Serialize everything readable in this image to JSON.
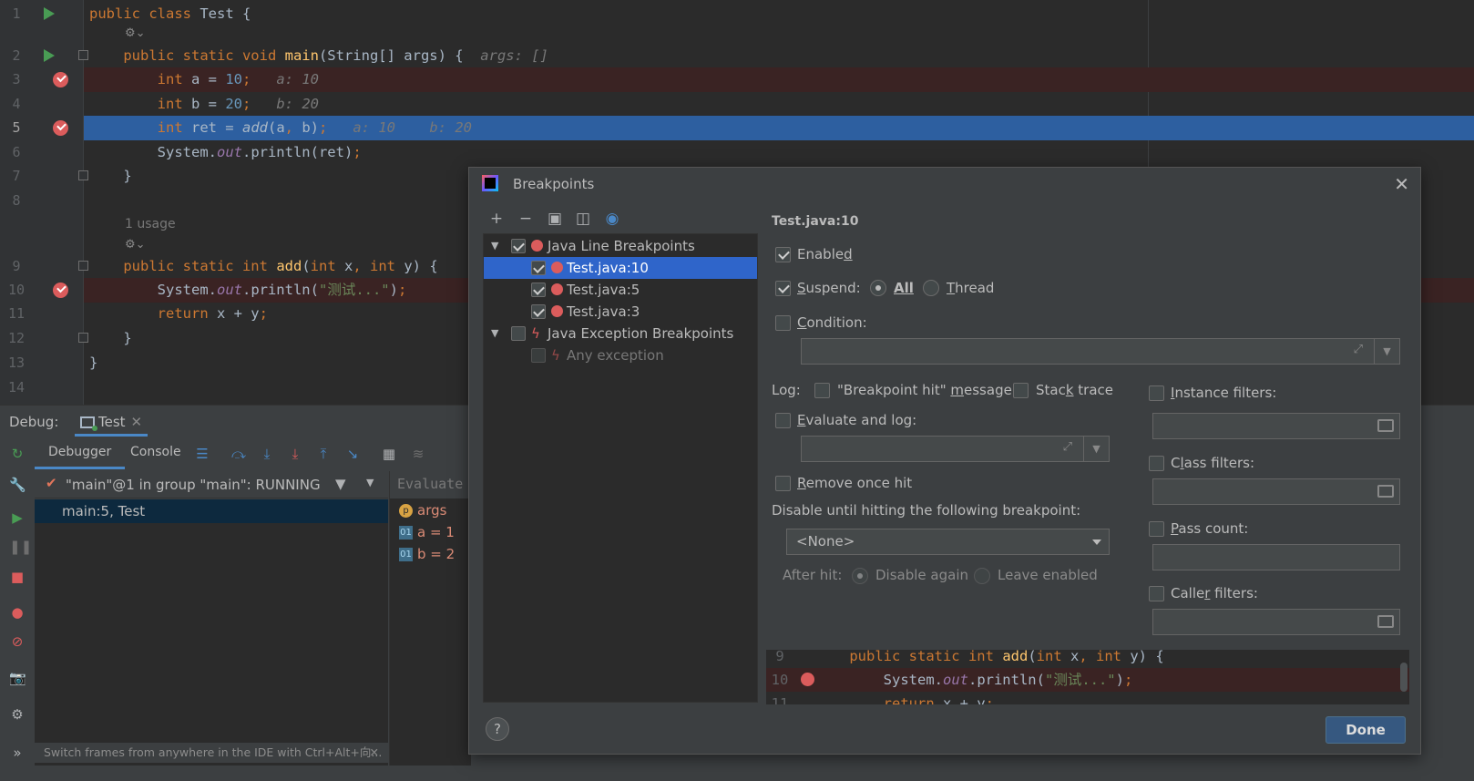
{
  "editor": {
    "lines": [
      {
        "num": "1"
      },
      {
        "num": "2"
      },
      {
        "num": "3"
      },
      {
        "num": "4"
      },
      {
        "num": "5"
      },
      {
        "num": "6"
      },
      {
        "num": "7"
      },
      {
        "num": "8"
      },
      {
        "num": "9"
      },
      {
        "num": "10"
      },
      {
        "num": "11"
      },
      {
        "num": "12"
      },
      {
        "num": "13"
      },
      {
        "num": "14"
      }
    ],
    "usage_hint": "1 usage",
    "inline": {
      "args": "args: []",
      "a": "a: 10",
      "b": "b: 20",
      "ret_a": "a: 10",
      "ret_b": "b: 20"
    }
  },
  "debug": {
    "label": "Debug:",
    "run_tab": "Test",
    "tabs": [
      "Debugger",
      "Console"
    ],
    "thread": "\"main\"@1 in group \"main\": RUNNING",
    "frame": "main:5, Test",
    "evaluate_placeholder": "Evaluate",
    "vars": [
      {
        "badge": "p",
        "text": "args"
      },
      {
        "badge": "01",
        "text": "a = 1"
      },
      {
        "badge": "01",
        "text": "b = 2"
      }
    ],
    "status": "Switch frames from anywhere in the IDE with Ctrl+Alt+向..."
  },
  "dialog": {
    "title": "Breakpoints",
    "tree": {
      "line_group": "Java Line Breakpoints",
      "items": [
        "Test.java:10",
        "Test.java:5",
        "Test.java:3"
      ],
      "exception_group": "Java Exception Breakpoints",
      "exception_item": "Any exception"
    },
    "selected_title": "Test.java:10",
    "enabled_pre": "Enable",
    "enabled_u": "d",
    "suspend_pre": "",
    "suspend_u": "S",
    "suspend_post": "uspend:",
    "all": "All",
    "thread_u": "T",
    "thread_post": "hread",
    "condition_u": "C",
    "condition_post": "ondition:",
    "log_label": "Log:",
    "bp_hit_pre": "\"Breakpoint hit\" ",
    "bp_hit_u": "m",
    "bp_hit_post": "essage",
    "stack_pre": "Stac",
    "stack_u": "k",
    "stack_post": " trace",
    "eval_log_u": "E",
    "eval_log_post": "valuate and log:",
    "remove_u": "R",
    "remove_post": "emove once hit",
    "disable_until": "Disable until hitting the following breakpoint:",
    "none_option": "<None>",
    "after_hit": "After hit:",
    "disable_again": "Disable again",
    "leave_enabled": "Leave enabled",
    "instance_u": "I",
    "instance_post": "nstance filters:",
    "class_pre": "C",
    "class_u": "l",
    "class_post": "ass filters:",
    "pass_u": "P",
    "pass_post": "ass count:",
    "caller_pre": "Calle",
    "caller_u": "r",
    "caller_post": " filters:",
    "preview_lines": [
      {
        "num": "9"
      },
      {
        "num": "10"
      },
      {
        "num": "11"
      }
    ],
    "done": "Done",
    "help": "?"
  }
}
